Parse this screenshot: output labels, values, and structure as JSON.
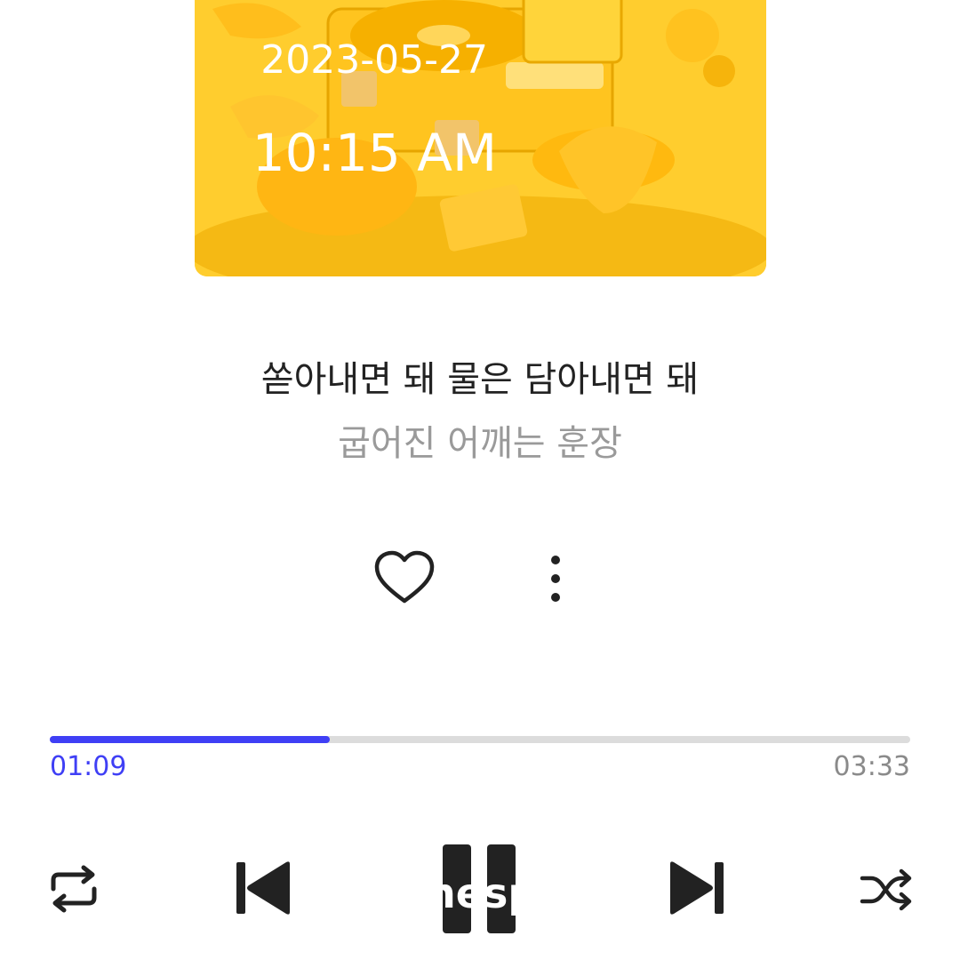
{
  "overlay": {
    "date": "2023-05-27",
    "time": "10:15 AM"
  },
  "lyrics": {
    "current": "쏟아내면 돼 물은 담아내면 돼",
    "next": "굽어진 어깨는 훈장"
  },
  "actions": {
    "like_icon": "heart-icon",
    "more_icon": "more-vertical-icon"
  },
  "playback": {
    "elapsed": "01:09",
    "total": "03:33",
    "progress_fraction": 0.325,
    "accent_color": "#3f3ff5"
  },
  "controls": {
    "repeat_icon": "repeat-icon",
    "previous_icon": "skip-previous-icon",
    "pause_icon": "pause-icon",
    "pause_overlay_text": "nesp",
    "next_icon": "skip-next-icon",
    "shuffle_icon": "shuffle-icon"
  }
}
